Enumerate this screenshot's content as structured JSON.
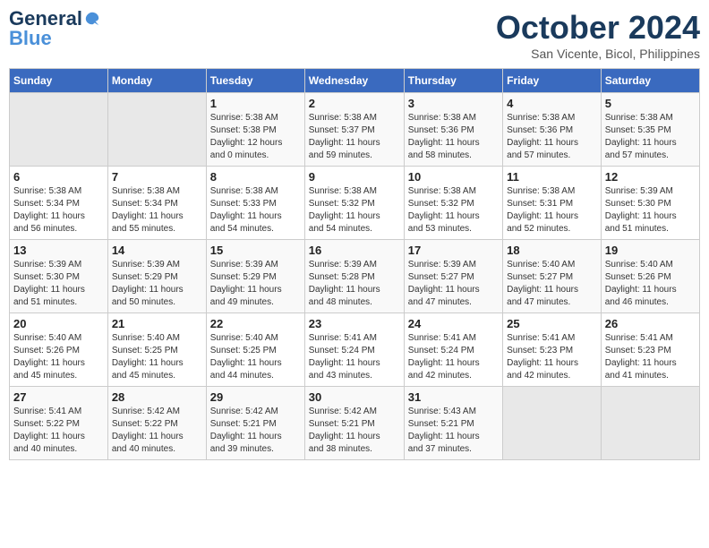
{
  "header": {
    "logo_line1": "General",
    "logo_line2": "Blue",
    "month_title": "October 2024",
    "subtitle": "San Vicente, Bicol, Philippines"
  },
  "weekdays": [
    "Sunday",
    "Monday",
    "Tuesday",
    "Wednesday",
    "Thursday",
    "Friday",
    "Saturday"
  ],
  "weeks": [
    [
      {
        "num": "",
        "info": ""
      },
      {
        "num": "",
        "info": ""
      },
      {
        "num": "1",
        "info": "Sunrise: 5:38 AM\nSunset: 5:38 PM\nDaylight: 12 hours\nand 0 minutes."
      },
      {
        "num": "2",
        "info": "Sunrise: 5:38 AM\nSunset: 5:37 PM\nDaylight: 11 hours\nand 59 minutes."
      },
      {
        "num": "3",
        "info": "Sunrise: 5:38 AM\nSunset: 5:36 PM\nDaylight: 11 hours\nand 58 minutes."
      },
      {
        "num": "4",
        "info": "Sunrise: 5:38 AM\nSunset: 5:36 PM\nDaylight: 11 hours\nand 57 minutes."
      },
      {
        "num": "5",
        "info": "Sunrise: 5:38 AM\nSunset: 5:35 PM\nDaylight: 11 hours\nand 57 minutes."
      }
    ],
    [
      {
        "num": "6",
        "info": "Sunrise: 5:38 AM\nSunset: 5:34 PM\nDaylight: 11 hours\nand 56 minutes."
      },
      {
        "num": "7",
        "info": "Sunrise: 5:38 AM\nSunset: 5:34 PM\nDaylight: 11 hours\nand 55 minutes."
      },
      {
        "num": "8",
        "info": "Sunrise: 5:38 AM\nSunset: 5:33 PM\nDaylight: 11 hours\nand 54 minutes."
      },
      {
        "num": "9",
        "info": "Sunrise: 5:38 AM\nSunset: 5:32 PM\nDaylight: 11 hours\nand 54 minutes."
      },
      {
        "num": "10",
        "info": "Sunrise: 5:38 AM\nSunset: 5:32 PM\nDaylight: 11 hours\nand 53 minutes."
      },
      {
        "num": "11",
        "info": "Sunrise: 5:38 AM\nSunset: 5:31 PM\nDaylight: 11 hours\nand 52 minutes."
      },
      {
        "num": "12",
        "info": "Sunrise: 5:39 AM\nSunset: 5:30 PM\nDaylight: 11 hours\nand 51 minutes."
      }
    ],
    [
      {
        "num": "13",
        "info": "Sunrise: 5:39 AM\nSunset: 5:30 PM\nDaylight: 11 hours\nand 51 minutes."
      },
      {
        "num": "14",
        "info": "Sunrise: 5:39 AM\nSunset: 5:29 PM\nDaylight: 11 hours\nand 50 minutes."
      },
      {
        "num": "15",
        "info": "Sunrise: 5:39 AM\nSunset: 5:29 PM\nDaylight: 11 hours\nand 49 minutes."
      },
      {
        "num": "16",
        "info": "Sunrise: 5:39 AM\nSunset: 5:28 PM\nDaylight: 11 hours\nand 48 minutes."
      },
      {
        "num": "17",
        "info": "Sunrise: 5:39 AM\nSunset: 5:27 PM\nDaylight: 11 hours\nand 47 minutes."
      },
      {
        "num": "18",
        "info": "Sunrise: 5:40 AM\nSunset: 5:27 PM\nDaylight: 11 hours\nand 47 minutes."
      },
      {
        "num": "19",
        "info": "Sunrise: 5:40 AM\nSunset: 5:26 PM\nDaylight: 11 hours\nand 46 minutes."
      }
    ],
    [
      {
        "num": "20",
        "info": "Sunrise: 5:40 AM\nSunset: 5:26 PM\nDaylight: 11 hours\nand 45 minutes."
      },
      {
        "num": "21",
        "info": "Sunrise: 5:40 AM\nSunset: 5:25 PM\nDaylight: 11 hours\nand 45 minutes."
      },
      {
        "num": "22",
        "info": "Sunrise: 5:40 AM\nSunset: 5:25 PM\nDaylight: 11 hours\nand 44 minutes."
      },
      {
        "num": "23",
        "info": "Sunrise: 5:41 AM\nSunset: 5:24 PM\nDaylight: 11 hours\nand 43 minutes."
      },
      {
        "num": "24",
        "info": "Sunrise: 5:41 AM\nSunset: 5:24 PM\nDaylight: 11 hours\nand 42 minutes."
      },
      {
        "num": "25",
        "info": "Sunrise: 5:41 AM\nSunset: 5:23 PM\nDaylight: 11 hours\nand 42 minutes."
      },
      {
        "num": "26",
        "info": "Sunrise: 5:41 AM\nSunset: 5:23 PM\nDaylight: 11 hours\nand 41 minutes."
      }
    ],
    [
      {
        "num": "27",
        "info": "Sunrise: 5:41 AM\nSunset: 5:22 PM\nDaylight: 11 hours\nand 40 minutes."
      },
      {
        "num": "28",
        "info": "Sunrise: 5:42 AM\nSunset: 5:22 PM\nDaylight: 11 hours\nand 40 minutes."
      },
      {
        "num": "29",
        "info": "Sunrise: 5:42 AM\nSunset: 5:21 PM\nDaylight: 11 hours\nand 39 minutes."
      },
      {
        "num": "30",
        "info": "Sunrise: 5:42 AM\nSunset: 5:21 PM\nDaylight: 11 hours\nand 38 minutes."
      },
      {
        "num": "31",
        "info": "Sunrise: 5:43 AM\nSunset: 5:21 PM\nDaylight: 11 hours\nand 37 minutes."
      },
      {
        "num": "",
        "info": ""
      },
      {
        "num": "",
        "info": ""
      }
    ]
  ]
}
